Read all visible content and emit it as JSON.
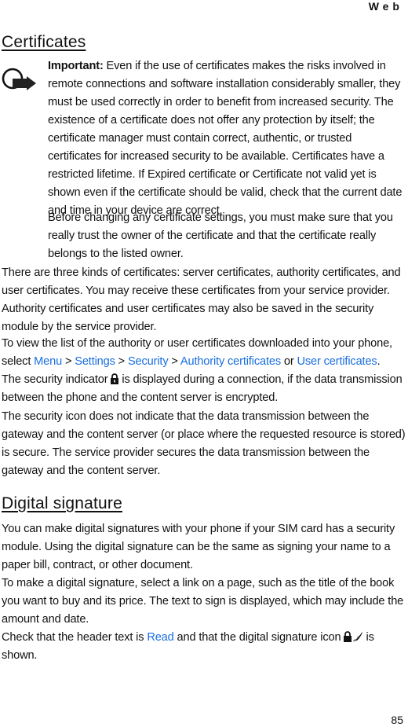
{
  "header": {
    "running_title": "Web"
  },
  "sections": {
    "certificates": {
      "title": "Certificates",
      "note": {
        "icon": "important-note-icon",
        "label": "Important:",
        "text1": " Even if the use of certificates makes the risks involved in remote connections and software installation considerably smaller, they must be used correctly in order to benefit from increased security. The existence of a certificate does not offer any protection by itself; the certificate manager must contain correct, authentic, or trusted certificates for increased security to be available. Certificates have a restricted lifetime. If Expired certificate or Certificate not valid yet is shown even if the certificate should be valid, check that the current date and time in your device are correct.",
        "text2": "Before changing any certificate settings, you must make sure that you really trust the owner of the certificate and that the certificate really belongs to the listed owner."
      },
      "para_kinds": "There are three kinds of certificates: server certificates, authority certificates, and user certificates. You may receive these certificates from your service provider. Authority certificates and user certificates may also be saved in the security module by the service provider.",
      "para_view": {
        "before": "To view the list of the authority or user certificates downloaded into your phone, select ",
        "menu_path": [
          "Menu",
          "Settings",
          "Security",
          "Authority certificates"
        ],
        "separator": " > ",
        "or": " or ",
        "alt": "User certificates",
        "end": "."
      },
      "para_indicator": {
        "before": "The security indicator",
        "icon": "lock-icon",
        "after": "is displayed during a connection, if the data transmission between the phone and the content server is encrypted."
      },
      "para_security_icon": "The security icon does not indicate that the data transmission between the gateway and the content server (or place where the requested resource is stored) is secure. The service provider secures the data transmission between the gateway and the content server."
    },
    "digital_signature": {
      "title": "Digital signature",
      "para1": "You can make digital signatures with your phone if your SIM card has a security module. Using the digital signature can be the same as signing your name to a paper bill, contract, or other document.",
      "para2": "To make a digital signature, select a link on a page, such as the title of the book you want to buy and its price. The text to sign is displayed, which may include the amount and date.",
      "para3": {
        "before": "Check that the header text is ",
        "highlight": "Read",
        "middle": " and that the digital signature icon",
        "icon": "digital-signature-icon",
        "after": "is shown."
      }
    }
  },
  "colors": {
    "link": "#1a6fe0",
    "text": "#111111"
  },
  "footer": {
    "page_number": "85"
  }
}
